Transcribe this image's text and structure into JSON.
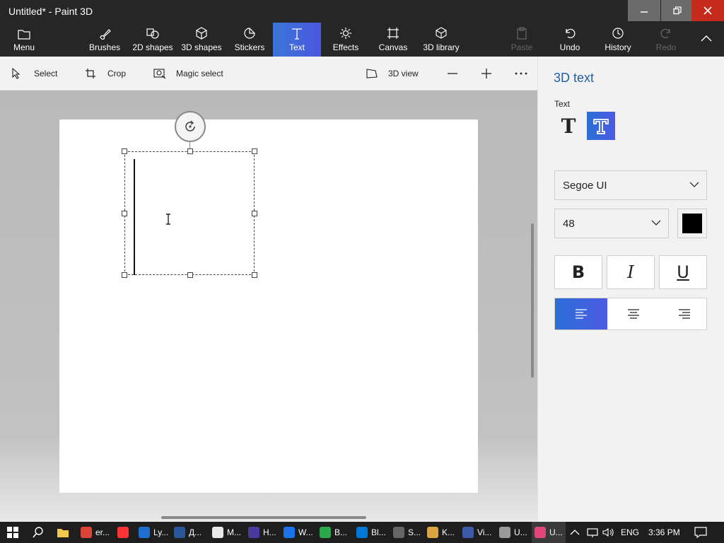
{
  "window": {
    "title": "Untitled* - Paint 3D"
  },
  "ribbon": {
    "menu": "Menu",
    "tabs": [
      {
        "label": "Brushes",
        "icon": "brush-icon"
      },
      {
        "label": "2D shapes",
        "icon": "2d-shapes-icon"
      },
      {
        "label": "3D shapes",
        "icon": "3d-shapes-icon"
      },
      {
        "label": "Stickers",
        "icon": "stickers-icon"
      },
      {
        "label": "Text",
        "icon": "text-icon",
        "active": true
      },
      {
        "label": "Effects",
        "icon": "effects-icon"
      },
      {
        "label": "Canvas",
        "icon": "canvas-icon"
      },
      {
        "label": "3D library",
        "icon": "3d-library-icon"
      }
    ],
    "actions": [
      {
        "label": "Paste",
        "icon": "paste-icon",
        "disabled": true
      },
      {
        "label": "Undo",
        "icon": "undo-icon"
      },
      {
        "label": "History",
        "icon": "history-icon"
      },
      {
        "label": "Redo",
        "icon": "redo-icon",
        "disabled": true
      }
    ]
  },
  "toolbar": {
    "select": "Select",
    "crop": "Crop",
    "magic_select": "Magic select",
    "view_3d": "3D view"
  },
  "panel": {
    "title": "3D text",
    "text_label": "Text",
    "font": "Segoe UI",
    "size": "48",
    "color": "#000000",
    "bold": "B",
    "italic": "I",
    "underline": "U",
    "accent": "#2b6fd6"
  },
  "taskbar": {
    "apps": [
      {
        "label": "er...",
        "icon": "chrome-icon",
        "color": "#db4437"
      },
      {
        "label": "",
        "icon": "yandex-icon",
        "color": "#ff3333"
      },
      {
        "label": "Ly...",
        "icon": "lync-icon",
        "color": "#1e6fcf"
      },
      {
        "label": "Д...",
        "icon": "word-icon",
        "color": "#2b579a"
      },
      {
        "label": "M...",
        "icon": "calendar-icon",
        "color": "#e8e8e8"
      },
      {
        "label": "H...",
        "icon": "media-icon",
        "color": "#4a3aa0"
      },
      {
        "label": "W...",
        "icon": "window-icon",
        "color": "#1a73e8"
      },
      {
        "label": "B...",
        "icon": "folder-app-icon",
        "color": "#2aa84a"
      },
      {
        "label": "Bl...",
        "icon": "bluetooth-icon",
        "color": "#0078d7"
      },
      {
        "label": "S...",
        "icon": "microphone-icon",
        "color": "#666666"
      },
      {
        "label": "K...",
        "icon": "keyboard-icon",
        "color": "#d9a441"
      },
      {
        "label": "Vi...",
        "icon": "monitor-icon",
        "color": "#3d5aa8"
      },
      {
        "label": "U...",
        "icon": "tools-icon",
        "color": "#9a9a9a"
      },
      {
        "label": "U...",
        "icon": "paint3d-icon",
        "color": "#e0457b",
        "active": true
      }
    ],
    "lang": "ENG",
    "time": "3:36 PM"
  }
}
